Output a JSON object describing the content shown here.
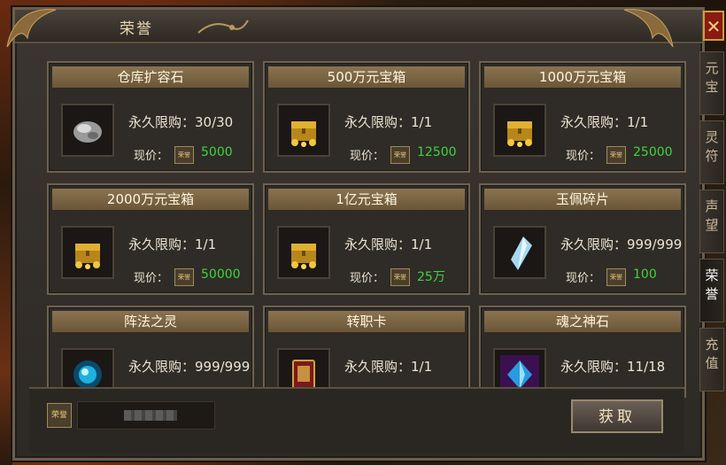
{
  "window": {
    "title": "荣誉",
    "close_glyph": "✕"
  },
  "items": [
    {
      "name": "仓库扩容石",
      "limit_label": "永久限购：30/30",
      "price_label": "现价：",
      "currency_icon": "荣誉",
      "price": "5000",
      "icon": "stone-icon"
    },
    {
      "name": "500万元宝箱",
      "limit_label": "永久限购：1/1",
      "price_label": "现价：",
      "currency_icon": "荣誉",
      "price": "12500",
      "icon": "gold-chest-icon"
    },
    {
      "name": "1000万元宝箱",
      "limit_label": "永久限购：1/1",
      "price_label": "现价：",
      "currency_icon": "荣誉",
      "price": "25000",
      "icon": "gold-chest-icon"
    },
    {
      "name": "2000万元宝箱",
      "limit_label": "永久限购：1/1",
      "price_label": "现价：",
      "currency_icon": "荣誉",
      "price": "50000",
      "icon": "gold-chest-icon"
    },
    {
      "name": "1亿元宝箱",
      "limit_label": "永久限购：1/1",
      "price_label": "现价：",
      "currency_icon": "荣誉",
      "price": "25万",
      "icon": "gold-chest-icon"
    },
    {
      "name": "玉佩碎片",
      "limit_label": "永久限购：999/999",
      "price_label": "现价：",
      "currency_icon": "荣誉",
      "price": "100",
      "icon": "crystal-icon"
    },
    {
      "name": "阵法之灵",
      "limit_label": "永久限购：999/999",
      "price_label": "",
      "currency_icon": "",
      "price": "",
      "icon": "orb-icon"
    },
    {
      "name": "转职卡",
      "limit_label": "永久限购：1/1",
      "price_label": "",
      "currency_icon": "",
      "price": "",
      "icon": "card-icon"
    },
    {
      "name": "魂之神石",
      "limit_label": "永久限购：11/18",
      "price_label": "",
      "currency_icon": "",
      "price": "",
      "icon": "soul-stone-icon"
    }
  ],
  "bottom": {
    "currency_icon": "荣誉",
    "button_label": "获取"
  },
  "tabs": [
    {
      "label": "元宝",
      "active": false
    },
    {
      "label": "灵符",
      "active": false
    },
    {
      "label": "声望",
      "active": false
    },
    {
      "label": "荣誉",
      "active": true
    },
    {
      "label": "充值",
      "active": false
    }
  ],
  "colors": {
    "price": "#3ed43e",
    "header": "#7a6444",
    "panel": "#2f2b27",
    "close": "#8a1a12"
  }
}
